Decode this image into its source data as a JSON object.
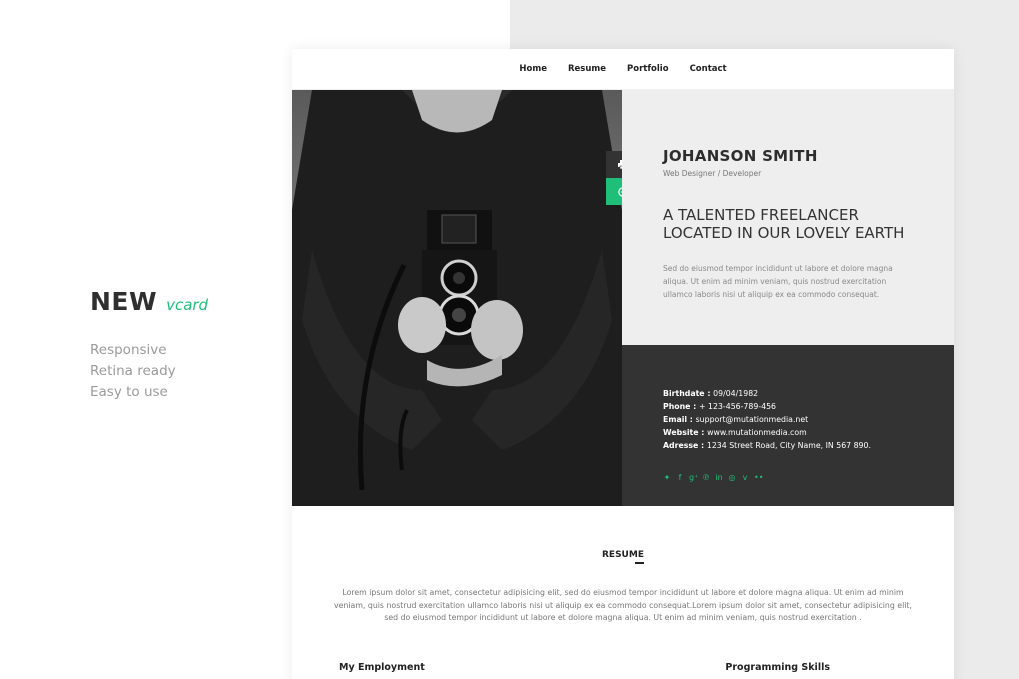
{
  "promo": {
    "title": "NEW",
    "subtitle": "vcard",
    "features": [
      "Responsive",
      "Retina ready",
      "Easy to use"
    ]
  },
  "nav": {
    "items": [
      "Home",
      "Resume",
      "Portfolio",
      "Contact"
    ]
  },
  "profile": {
    "name": "JOHANSON SMITH",
    "role": "Web Designer / Developer",
    "tagline_line1": "A TALENTED FREELANCER",
    "tagline_line2": "LOCATED IN OUR LOVELY EARTH",
    "intro": "Sed do eiusmod tempor incididunt ut labore et dolore magna aliqua. Ut enim ad minim veniam, quis nostrud exercitation ullamco laboris nisi ut aliquip ex ea commodo consequat."
  },
  "details": [
    {
      "label": "Birthdate",
      "value": "09/04/1982"
    },
    {
      "label": "Phone",
      "value": "+ 123-456-789-456"
    },
    {
      "label": "Email",
      "value": "support@mutationmedia.net"
    },
    {
      "label": "Website",
      "value": "www.mutationmedia.com"
    },
    {
      "label": "Adresse",
      "value": "1234 Street Road, City Name, IN 567 890."
    }
  ],
  "socials": [
    "twitter-icon",
    "facebook-icon",
    "google-plus-icon",
    "pinterest-icon",
    "linkedin-icon",
    "dribbble-icon",
    "vimeo-icon",
    "flickr-icon"
  ],
  "resume": {
    "title": "RESUME",
    "text": "Lorem ipsum dolor sit amet, consectetur adipisicing elit, sed do eiusmod tempor incididunt ut labore et dolore magna aliqua. Ut enim ad minim veniam, quis nostrud exercitation ullamco laboris nisi ut aliquip ex ea commodo consequat.Lorem ipsum dolor sit amet, consectetur adipisicing elit, sed do eiusmod tempor incididunt ut labore et dolore magna aliqua. Ut enim ad minim veniam, quis nostrud exercitation .",
    "section_left": "My Employment",
    "section_right": "Programming Skills"
  },
  "colors": {
    "accent": "#1fbf7a",
    "dark": "#333333",
    "light_panel": "#eeeeee"
  }
}
